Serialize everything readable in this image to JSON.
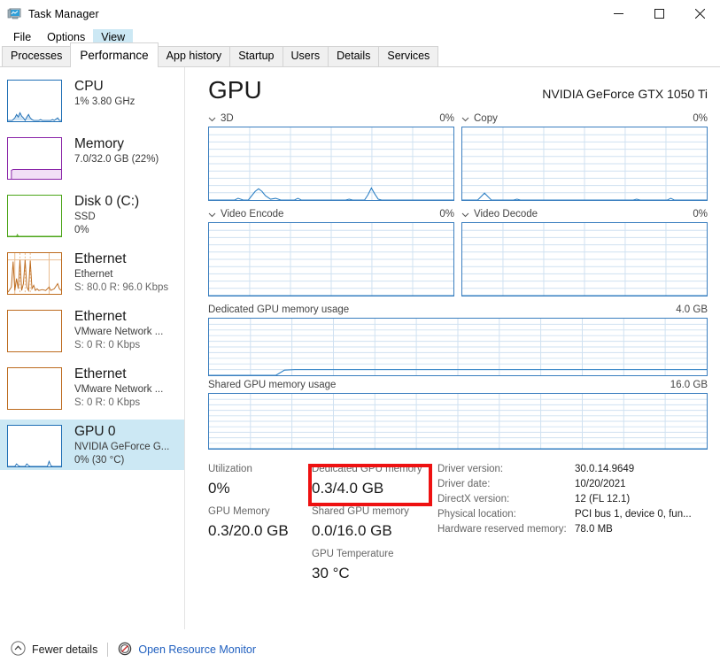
{
  "window": {
    "title": "Task Manager",
    "icon": "task-manager-icon",
    "minimize": "─",
    "maximize": "□",
    "close": "✕"
  },
  "menu": {
    "items": [
      {
        "label": "File",
        "active": false
      },
      {
        "label": "Options",
        "active": false
      },
      {
        "label": "View",
        "active": true
      }
    ]
  },
  "tabs": [
    {
      "label": "Processes",
      "active": false
    },
    {
      "label": "Performance",
      "active": true
    },
    {
      "label": "App history",
      "active": false
    },
    {
      "label": "Startup",
      "active": false
    },
    {
      "label": "Users",
      "active": false
    },
    {
      "label": "Details",
      "active": false
    },
    {
      "label": "Services",
      "active": false
    }
  ],
  "sidebar": {
    "items": [
      {
        "title": "CPU",
        "sub1": "1%  3.80 GHz",
        "sub2": "",
        "color": "#1f6fb5",
        "selected": false
      },
      {
        "title": "Memory",
        "sub1": "7.0/32.0 GB (22%)",
        "sub2": "",
        "color": "#8a24a8",
        "selected": false
      },
      {
        "title": "Disk 0 (C:)",
        "sub1": "SSD",
        "sub2": "0%",
        "color": "#4ba517",
        "selected": false
      },
      {
        "title": "Ethernet",
        "sub1": "Ethernet",
        "sub2": "S: 80.0 R: 96.0 Kbps",
        "color": "#bd6b1e",
        "selected": false
      },
      {
        "title": "Ethernet",
        "sub1": "VMware Network ...",
        "sub2": "S: 0 R: 0 Kbps",
        "color": "#bd6b1e",
        "selected": false
      },
      {
        "title": "Ethernet",
        "sub1": "VMware Network ...",
        "sub2": "S: 0 R: 0 Kbps",
        "color": "#bd6b1e",
        "selected": false
      },
      {
        "title": "GPU 0",
        "sub1": "NVIDIA GeForce G...",
        "sub2": "0%  (30 °C)",
        "color": "#1f6fb5",
        "selected": true
      }
    ]
  },
  "main": {
    "title": "GPU",
    "device": "NVIDIA GeForce GTX 1050 Ti",
    "engines": [
      {
        "name": "3D",
        "value": "0%"
      },
      {
        "name": "Copy",
        "value": "0%"
      },
      {
        "name": "Video Encode",
        "value": "0%"
      },
      {
        "name": "Video Decode",
        "value": "0%"
      }
    ],
    "memory_graphs": [
      {
        "name": "Dedicated GPU memory usage",
        "max": "4.0 GB"
      },
      {
        "name": "Shared GPU memory usage",
        "max": "16.0 GB"
      }
    ]
  },
  "stats": {
    "utilization_label": "Utilization",
    "utilization_value": "0%",
    "gpu_memory_label": "GPU Memory",
    "gpu_memory_value": "0.3/20.0 GB",
    "dedicated_label": "Dedicated GPU memory",
    "dedicated_value": "0.3/4.0 GB",
    "shared_label": "Shared GPU memory",
    "shared_value": "0.0/16.0 GB",
    "temperature_label": "GPU Temperature",
    "temperature_value": "30 °C"
  },
  "driver": {
    "rows": [
      {
        "key": "Driver version:",
        "value": "30.0.14.9649"
      },
      {
        "key": "Driver date:",
        "value": "10/20/2021"
      },
      {
        "key": "DirectX version:",
        "value": "12 (FL 12.1)"
      },
      {
        "key": "Physical location:",
        "value": "PCI bus 1, device 0, fun..."
      },
      {
        "key": "Hardware reserved memory:",
        "value": "78.0 MB"
      }
    ]
  },
  "footer": {
    "fewer_details": "Fewer details",
    "resource_monitor": "Open Resource Monitor"
  },
  "colors": {
    "accent_blue": "#1f6fb5",
    "graph_border": "#3a7ebf",
    "selection": "#cce8f4",
    "highlight_red": "#ee1111",
    "link": "#1f5fbf"
  }
}
